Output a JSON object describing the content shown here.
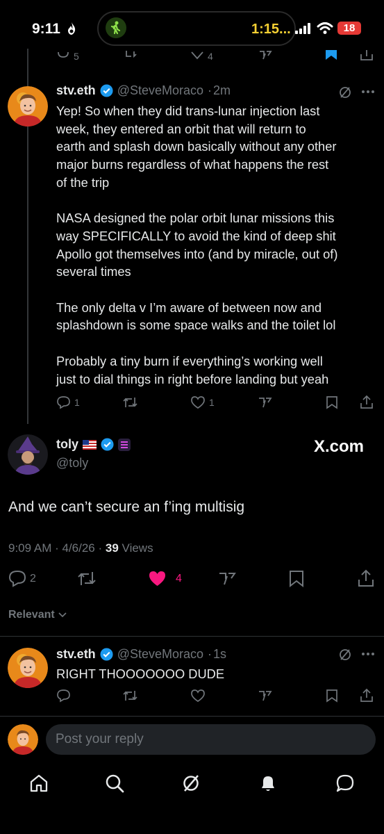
{
  "status_bar": {
    "time": "9:11",
    "activity": "1:15...",
    "battery": "18"
  },
  "top_actions": {
    "reply_count": "5",
    "like_count": "4"
  },
  "tweet1": {
    "name": "stv.eth",
    "handle": "@SteveMoraco",
    "time": "2m",
    "paragraphs": [
      [
        "Yep! So when they did trans-lunar injection last",
        "week, they entered an orbit that will return to",
        "earth and splash down basically without any other",
        "major burns regardless of what happens the rest",
        "of the trip"
      ],
      [
        "NASA designed the polar orbit lunar missions this",
        "way SPECIFICALLY to avoid the kind of deep shit",
        "Apollo got themselves into (and by miracle, out of)",
        "several times"
      ],
      [
        "The only delta v I’m aware of between now and",
        "splashdown is some space walks and the toilet lol"
      ],
      [
        "Probably a tiny burn if everything’s working well",
        "just to dial things in right before landing but yeah"
      ]
    ],
    "reply_count": "1",
    "like_count": "1"
  },
  "main_tweet": {
    "name": "toly",
    "handle": "@toly",
    "watermark": "X.com",
    "text": "And we can’t secure an f’ing multisig",
    "timestamp": "9:09 AM · 4/6/26 ·",
    "views_count": "39",
    "views_label": "Views",
    "reply_count": "2",
    "like_count": "4",
    "sort_label": "Relevant"
  },
  "reply": {
    "name": "stv.eth",
    "handle": "@SteveMoraco",
    "time": "1s",
    "text": "RIGHT THOOOOOOO DUDE"
  },
  "compose": {
    "placeholder": "Post your reply"
  },
  "colors": {
    "verified": "#1d9bf0",
    "like_active": "#f91880",
    "muted": "#71767b",
    "text": "#e7e9ea"
  }
}
